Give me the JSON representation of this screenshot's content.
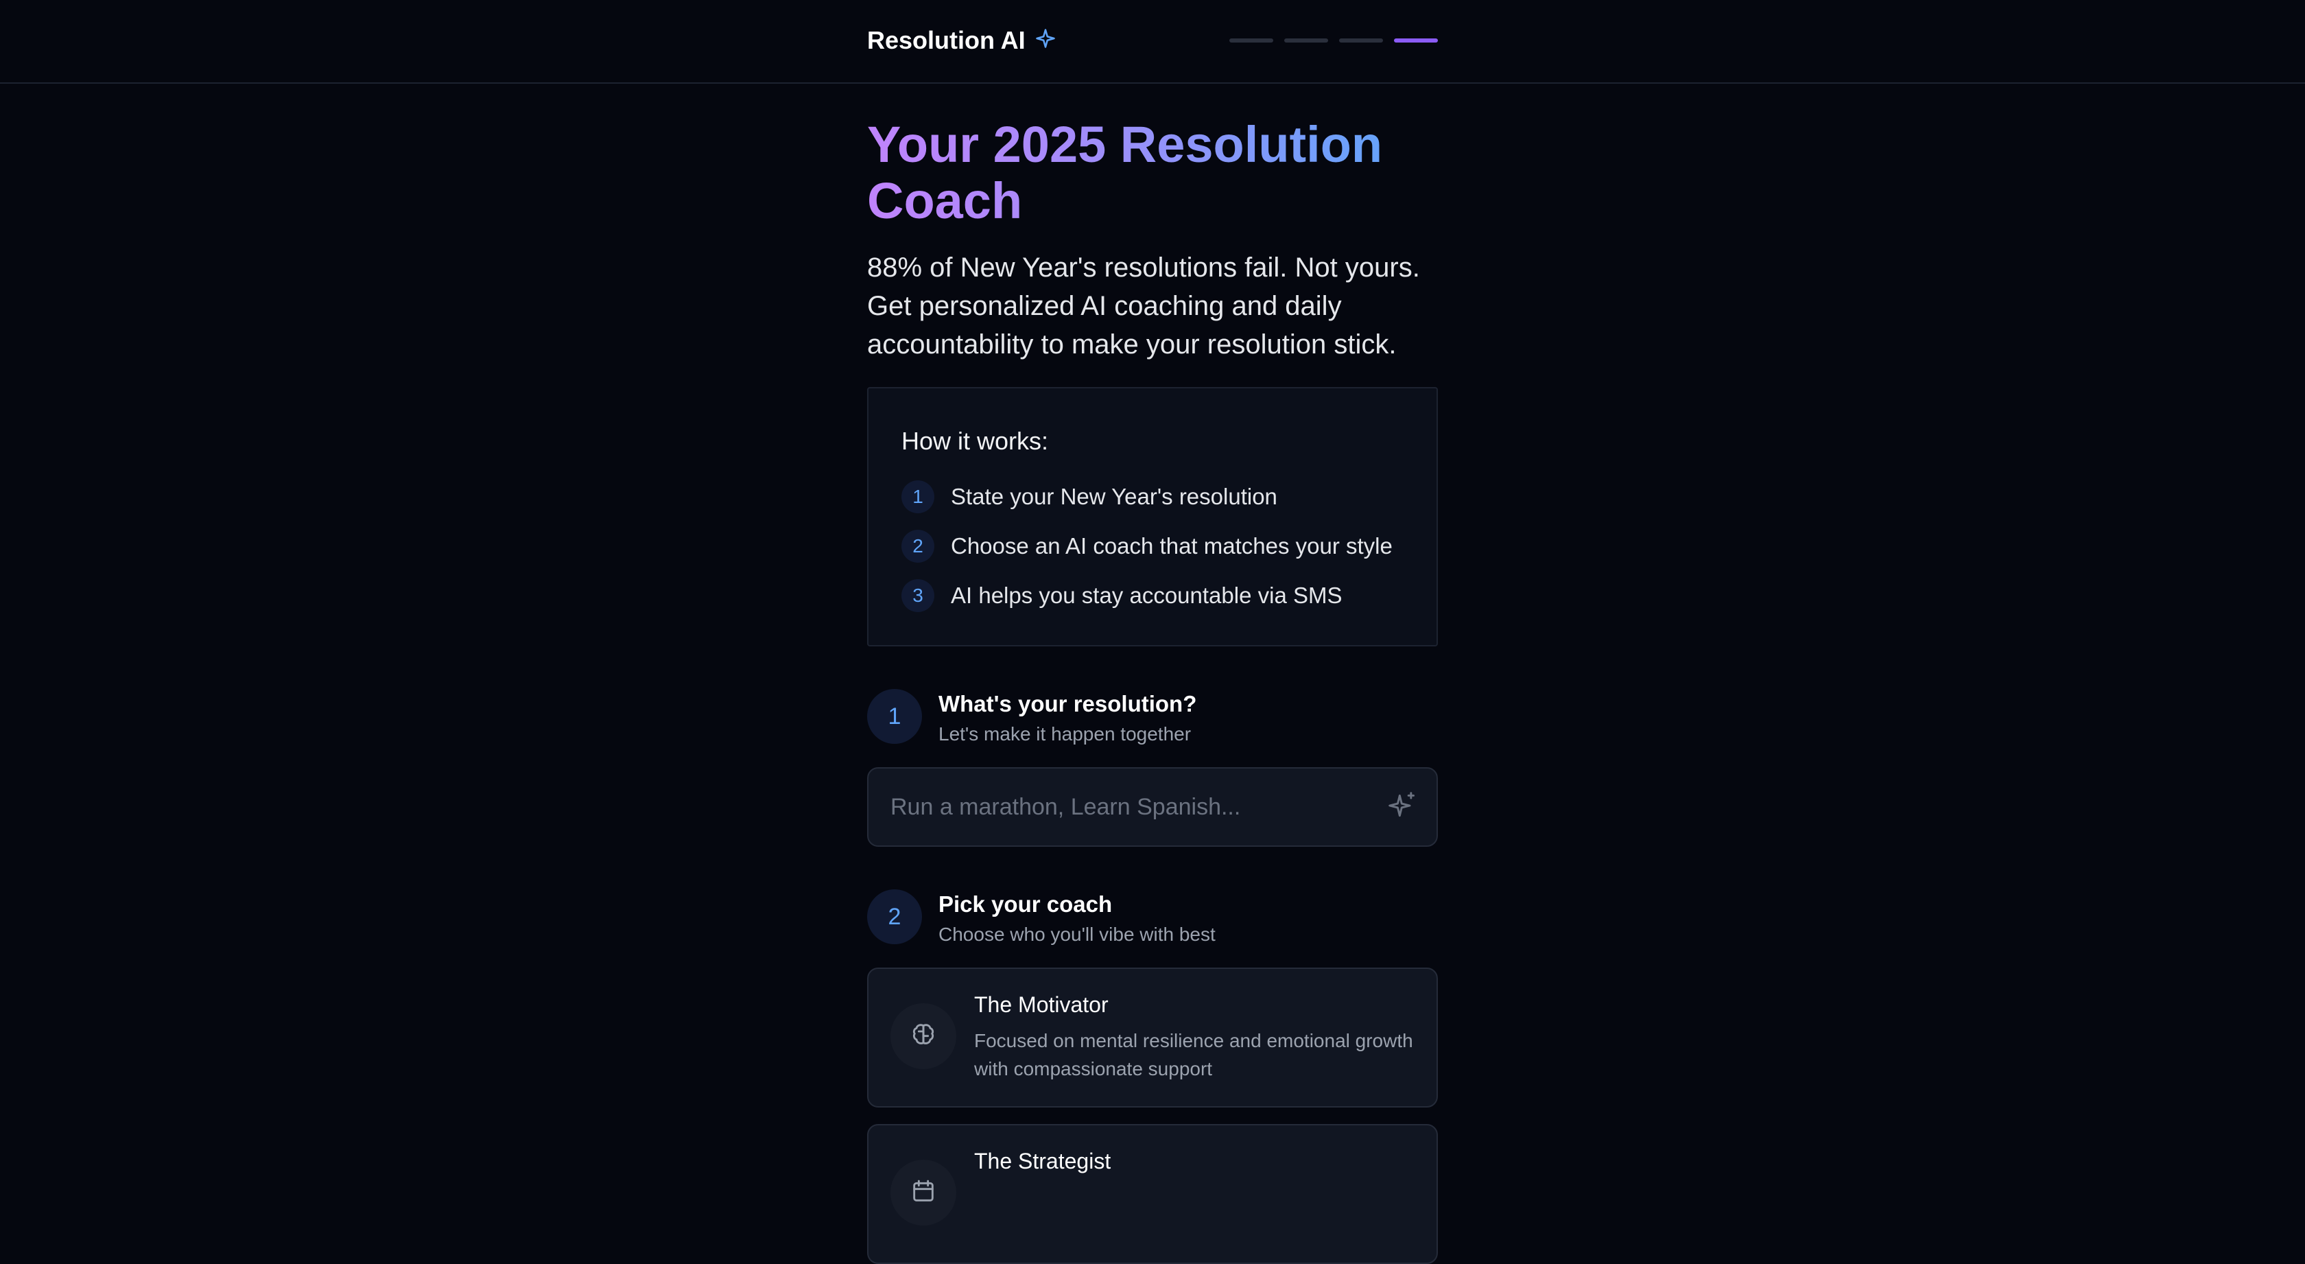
{
  "header": {
    "brand": "Resolution AI",
    "brand_icon": "sparkle-icon",
    "progress": {
      "total_steps": 4,
      "current_step": 4
    }
  },
  "hero": {
    "title": "Your 2025 Resolution Coach",
    "subtitle": "88% of New Year's resolutions fail. Not yours. Get personalized AI coaching and daily accountability to make your resolution stick."
  },
  "how_it_works": {
    "title": "How it works:",
    "items": [
      {
        "number": "1",
        "text": "State your New Year's resolution"
      },
      {
        "number": "2",
        "text": "Choose an AI coach that matches your style"
      },
      {
        "number": "3",
        "text": "AI helps you stay accountable via SMS"
      }
    ]
  },
  "step1": {
    "number": "1",
    "title": "What's your resolution?",
    "subtitle": "Let's make it happen together",
    "input": {
      "value": "",
      "placeholder": "Run a marathon, Learn Spanish..."
    }
  },
  "step2": {
    "number": "2",
    "title": "Pick your coach",
    "subtitle": "Choose who you'll vibe with best",
    "coaches": [
      {
        "name": "The Motivator",
        "icon": "brain-icon",
        "description": "Focused on mental resilience and emotional growth with compassionate support"
      },
      {
        "name": "The Strategist",
        "icon": "calendar-icon",
        "description": ""
      }
    ]
  },
  "colors": {
    "background": "#05070f",
    "accent_purple": "#8b5cf6",
    "accent_blue": "#60a5fa",
    "card": "#111622"
  }
}
